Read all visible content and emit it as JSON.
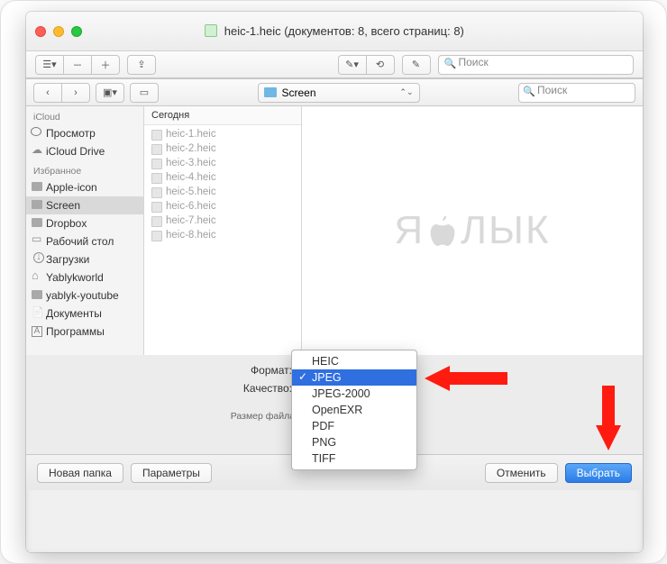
{
  "window": {
    "title": "heic-1.heic (документов: 8, всего страниц: 8)"
  },
  "toolbar": {
    "search_placeholder": "Поиск"
  },
  "sheet": {
    "path_label": "Screen",
    "search_placeholder": "Поиск",
    "column_header": "Сегодня",
    "files": [
      "heic-1.heic",
      "heic-2.heic",
      "heic-3.heic",
      "heic-4.heic",
      "heic-5.heic",
      "heic-6.heic",
      "heic-7.heic",
      "heic-8.heic"
    ]
  },
  "sidebar": {
    "sections": [
      {
        "label": "iCloud",
        "items": [
          {
            "label": "Просмотр",
            "icon": "preview"
          },
          {
            "label": "iCloud Drive",
            "icon": "cloud"
          }
        ]
      },
      {
        "label": "Избранное",
        "items": [
          {
            "label": "Apple-icon",
            "icon": "folder"
          },
          {
            "label": "Screen",
            "icon": "folder",
            "selected": true
          },
          {
            "label": "Dropbox",
            "icon": "folder"
          },
          {
            "label": "Рабочий стол",
            "icon": "desktop"
          },
          {
            "label": "Загрузки",
            "icon": "download"
          },
          {
            "label": "Yablykworld",
            "icon": "home"
          },
          {
            "label": "yablyk-youtube",
            "icon": "folder"
          },
          {
            "label": "Документы",
            "icon": "doc"
          },
          {
            "label": "Программы",
            "icon": "app"
          }
        ]
      }
    ]
  },
  "watermark": {
    "left": "Я",
    "right": "ЛЫК"
  },
  "options": {
    "format_label": "Формат:",
    "quality_label": "Качество:",
    "size_label": "Размер файла:",
    "format_items": [
      "HEIC",
      "JPEG",
      "JPEG-2000",
      "OpenEXR",
      "PDF",
      "PNG",
      "TIFF"
    ],
    "format_selected": "JPEG"
  },
  "buttons": {
    "new_folder": "Новая папка",
    "options": "Параметры",
    "cancel": "Отменить",
    "choose": "Выбрать"
  },
  "behind": {
    "thumb_label": "heic-5.heic"
  }
}
